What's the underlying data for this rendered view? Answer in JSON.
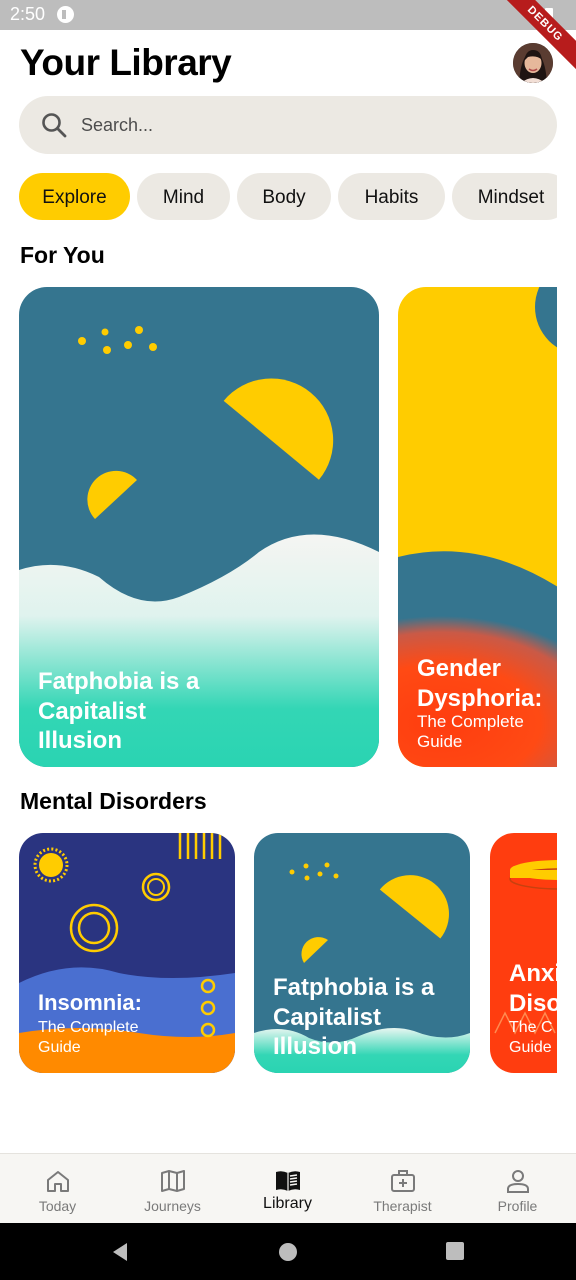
{
  "status_bar": {
    "time": "2:50",
    "ribbon": "DEBUG"
  },
  "header": {
    "title": "Your Library",
    "avatar_icon": "user-avatar"
  },
  "search": {
    "placeholder": "Search..."
  },
  "chips": [
    {
      "label": "Explore",
      "active": true
    },
    {
      "label": "Mind",
      "active": false
    },
    {
      "label": "Body",
      "active": false
    },
    {
      "label": "Habits",
      "active": false
    },
    {
      "label": "Mindset",
      "active": false
    }
  ],
  "sections": {
    "for_you": {
      "title": "For You",
      "cards": [
        {
          "title_lines": [
            "Fatphobia is a",
            "Capitalist",
            "Illusion"
          ]
        },
        {
          "title_lines": [
            "Gender",
            "Dysphoria:"
          ],
          "subtitle_lines": [
            "The Complete",
            "Guide"
          ]
        }
      ]
    },
    "mental_disorders": {
      "title": "Mental Disorders",
      "cards": [
        {
          "title_lines": [
            "Insomnia:"
          ],
          "subtitle_lines": [
            "The Complete",
            "Guide"
          ]
        },
        {
          "title_lines": [
            "Fatphobia is a",
            "Capitalist",
            "Illusion"
          ]
        },
        {
          "title_lines": [
            "Anxi",
            "Diso"
          ],
          "subtitle_lines": [
            "The C",
            "Guide"
          ]
        }
      ]
    }
  },
  "bottom_nav": [
    {
      "label": "Today",
      "icon": "home-icon",
      "active": false
    },
    {
      "label": "Journeys",
      "icon": "map-icon",
      "active": false
    },
    {
      "label": "Library",
      "icon": "book-icon",
      "active": true
    },
    {
      "label": "Therapist",
      "icon": "medical-bag-icon",
      "active": false
    },
    {
      "label": "Profile",
      "icon": "person-icon",
      "active": false
    }
  ],
  "colors": {
    "accent": "#ffcc00",
    "teal": "#35758f",
    "mint": "#2fd6b4",
    "orange_red": "#ff3d0f",
    "navy": "#2a3480",
    "chip_bg": "#ece9e3"
  }
}
